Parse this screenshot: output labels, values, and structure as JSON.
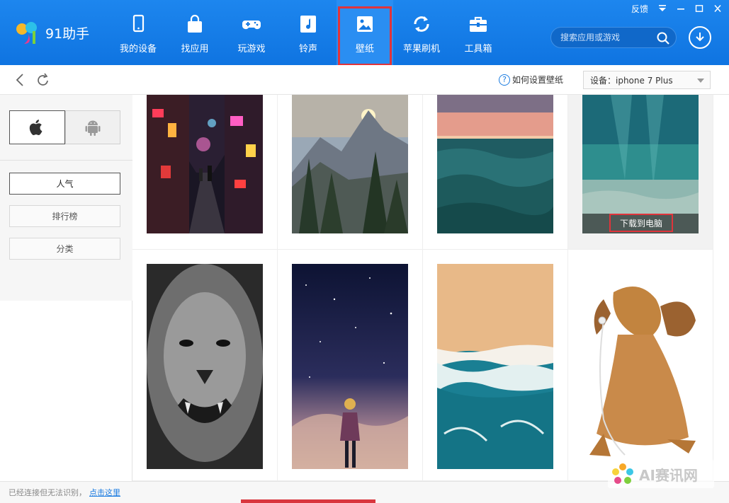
{
  "app": {
    "name": "91助手"
  },
  "window": {
    "feedback": "反馈",
    "menu_icon": "menu-triangle-icon",
    "minimize_icon": "minimize-icon",
    "maximize_icon": "maximize-icon",
    "close_icon": "close-icon"
  },
  "nav": [
    {
      "label": "我的设备",
      "icon": "phone-icon"
    },
    {
      "label": "找应用",
      "icon": "bag-icon"
    },
    {
      "label": "玩游戏",
      "icon": "gamepad-icon"
    },
    {
      "label": "铃声",
      "icon": "music-icon"
    },
    {
      "label": "壁纸",
      "icon": "picture-icon",
      "active": true
    },
    {
      "label": "苹果刷机",
      "icon": "refresh-icon"
    },
    {
      "label": "工具箱",
      "icon": "toolbox-icon"
    }
  ],
  "search": {
    "placeholder": "搜索应用或游戏"
  },
  "subbar": {
    "help": "如何设置壁纸",
    "device": "设备：iphone 7 Plus"
  },
  "sidebar": {
    "os_tabs": [
      "apple-icon",
      "android-icon"
    ],
    "categories": [
      {
        "label": "人气",
        "active": true
      },
      {
        "label": "排行榜"
      },
      {
        "label": "分类"
      }
    ]
  },
  "grid": {
    "download_label": "下载到电脑"
  },
  "wallpapers": [
    "night-alley-wallpaper",
    "mountain-forest-wallpaper",
    "ocean-sunset-wallpaper",
    "underwater-wallpaper",
    "lion-wallpaper",
    "starry-girl-wallpaper",
    "beach-aerial-wallpaper",
    "puppy-headphones-wallpaper"
  ],
  "status": {
    "text": "已经连接但无法识别，",
    "link": "点击这里"
  },
  "watermark": {
    "text": "AI赛讯网"
  },
  "colors": {
    "topbar": "#0f74e1",
    "highlight": "#e0343b",
    "link": "#1a7be0"
  }
}
